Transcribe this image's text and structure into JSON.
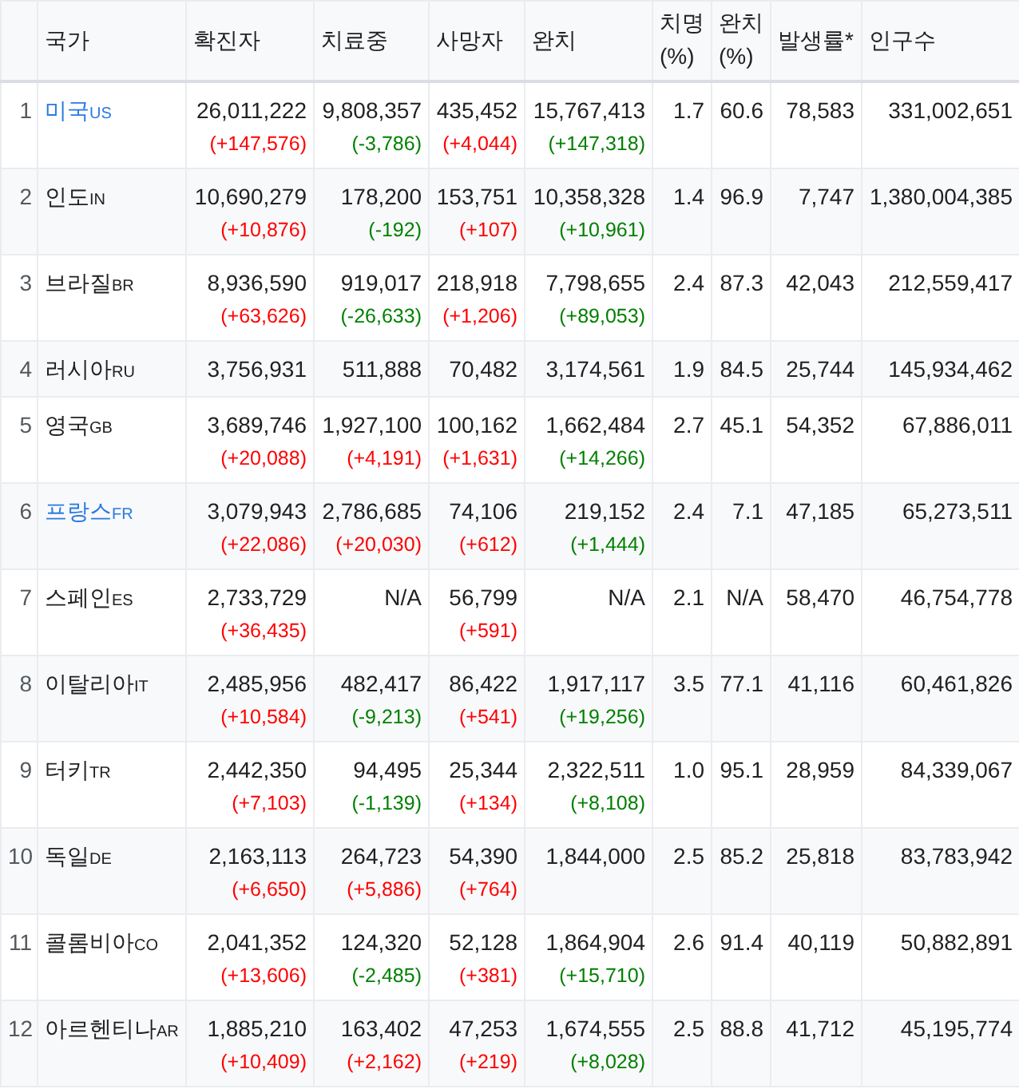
{
  "table": {
    "columns": [
      "국가",
      "확진자",
      "치료중",
      "사망자",
      "완치",
      "치명 (%)",
      "완치 (%)",
      "발생률*",
      "인구수"
    ],
    "rows": [
      {
        "rank": "1",
        "country": "미국",
        "code": "US",
        "linked": true,
        "confirmed": {
          "value": "26,011,222",
          "change": "(+147,576)",
          "kind": "worse"
        },
        "active": {
          "value": "9,808,357",
          "change": "(-3,786)",
          "kind": "better"
        },
        "deaths": {
          "value": "435,452",
          "change": "(+4,044)",
          "kind": "worse"
        },
        "recovered": {
          "value": "15,767,413",
          "change": "(+147,318)",
          "kind": "better"
        },
        "fatality": "1.7",
        "recovery_rate": "60.6",
        "incidence": "78,583",
        "population": "331,002,651"
      },
      {
        "rank": "2",
        "country": "인도",
        "code": "IN",
        "linked": false,
        "confirmed": {
          "value": "10,690,279",
          "change": "(+10,876)",
          "kind": "worse"
        },
        "active": {
          "value": "178,200",
          "change": "(-192)",
          "kind": "better"
        },
        "deaths": {
          "value": "153,751",
          "change": "(+107)",
          "kind": "worse"
        },
        "recovered": {
          "value": "10,358,328",
          "change": "(+10,961)",
          "kind": "better"
        },
        "fatality": "1.4",
        "recovery_rate": "96.9",
        "incidence": "7,747",
        "population": "1,380,004,385"
      },
      {
        "rank": "3",
        "country": "브라질",
        "code": "BR",
        "linked": false,
        "confirmed": {
          "value": "8,936,590",
          "change": "(+63,626)",
          "kind": "worse"
        },
        "active": {
          "value": "919,017",
          "change": "(-26,633)",
          "kind": "better"
        },
        "deaths": {
          "value": "218,918",
          "change": "(+1,206)",
          "kind": "worse"
        },
        "recovered": {
          "value": "7,798,655",
          "change": "(+89,053)",
          "kind": "better"
        },
        "fatality": "2.4",
        "recovery_rate": "87.3",
        "incidence": "42,043",
        "population": "212,559,417"
      },
      {
        "rank": "4",
        "country": "러시아",
        "code": "RU",
        "linked": false,
        "confirmed": {
          "value": "3,756,931"
        },
        "active": {
          "value": "511,888"
        },
        "deaths": {
          "value": "70,482"
        },
        "recovered": {
          "value": "3,174,561"
        },
        "fatality": "1.9",
        "recovery_rate": "84.5",
        "incidence": "25,744",
        "population": "145,934,462"
      },
      {
        "rank": "5",
        "country": "영국",
        "code": "GB",
        "linked": false,
        "confirmed": {
          "value": "3,689,746",
          "change": "(+20,088)",
          "kind": "worse"
        },
        "active": {
          "value": "1,927,100",
          "change": "(+4,191)",
          "kind": "worse"
        },
        "deaths": {
          "value": "100,162",
          "change": "(+1,631)",
          "kind": "worse"
        },
        "recovered": {
          "value": "1,662,484",
          "change": "(+14,266)",
          "kind": "better"
        },
        "fatality": "2.7",
        "recovery_rate": "45.1",
        "incidence": "54,352",
        "population": "67,886,011"
      },
      {
        "rank": "6",
        "country": "프랑스",
        "code": "FR",
        "linked": true,
        "confirmed": {
          "value": "3,079,943",
          "change": "(+22,086)",
          "kind": "worse"
        },
        "active": {
          "value": "2,786,685",
          "change": "(+20,030)",
          "kind": "worse"
        },
        "deaths": {
          "value": "74,106",
          "change": "(+612)",
          "kind": "worse"
        },
        "recovered": {
          "value": "219,152",
          "change": "(+1,444)",
          "kind": "better"
        },
        "fatality": "2.4",
        "recovery_rate": "7.1",
        "incidence": "47,185",
        "population": "65,273,511"
      },
      {
        "rank": "7",
        "country": "스페인",
        "code": "ES",
        "linked": false,
        "confirmed": {
          "value": "2,733,729",
          "change": "(+36,435)",
          "kind": "worse"
        },
        "active": {
          "value": "N/A"
        },
        "deaths": {
          "value": "56,799",
          "change": "(+591)",
          "kind": "worse"
        },
        "recovered": {
          "value": "N/A"
        },
        "fatality": "2.1",
        "recovery_rate": "N/A",
        "incidence": "58,470",
        "population": "46,754,778"
      },
      {
        "rank": "8",
        "country": "이탈리아",
        "code": "IT",
        "linked": false,
        "confirmed": {
          "value": "2,485,956",
          "change": "(+10,584)",
          "kind": "worse"
        },
        "active": {
          "value": "482,417",
          "change": "(-9,213)",
          "kind": "better"
        },
        "deaths": {
          "value": "86,422",
          "change": "(+541)",
          "kind": "worse"
        },
        "recovered": {
          "value": "1,917,117",
          "change": "(+19,256)",
          "kind": "better"
        },
        "fatality": "3.5",
        "recovery_rate": "77.1",
        "incidence": "41,116",
        "population": "60,461,826"
      },
      {
        "rank": "9",
        "country": "터키",
        "code": "TR",
        "linked": false,
        "confirmed": {
          "value": "2,442,350",
          "change": "(+7,103)",
          "kind": "worse"
        },
        "active": {
          "value": "94,495",
          "change": "(-1,139)",
          "kind": "better"
        },
        "deaths": {
          "value": "25,344",
          "change": "(+134)",
          "kind": "worse"
        },
        "recovered": {
          "value": "2,322,511",
          "change": "(+8,108)",
          "kind": "better"
        },
        "fatality": "1.0",
        "recovery_rate": "95.1",
        "incidence": "28,959",
        "population": "84,339,067"
      },
      {
        "rank": "10",
        "country": "독일",
        "code": "DE",
        "linked": false,
        "confirmed": {
          "value": "2,163,113",
          "change": "(+6,650)",
          "kind": "worse"
        },
        "active": {
          "value": "264,723",
          "change": "(+5,886)",
          "kind": "worse"
        },
        "deaths": {
          "value": "54,390",
          "change": "(+764)",
          "kind": "worse"
        },
        "recovered": {
          "value": "1,844,000"
        },
        "fatality": "2.5",
        "recovery_rate": "85.2",
        "incidence": "25,818",
        "population": "83,783,942"
      },
      {
        "rank": "11",
        "country": "콜롬비아",
        "code": "CO",
        "linked": false,
        "confirmed": {
          "value": "2,041,352",
          "change": "(+13,606)",
          "kind": "worse"
        },
        "active": {
          "value": "124,320",
          "change": "(-2,485)",
          "kind": "better"
        },
        "deaths": {
          "value": "52,128",
          "change": "(+381)",
          "kind": "worse"
        },
        "recovered": {
          "value": "1,864,904",
          "change": "(+15,710)",
          "kind": "better"
        },
        "fatality": "2.6",
        "recovery_rate": "91.4",
        "incidence": "40,119",
        "population": "50,882,891"
      },
      {
        "rank": "12",
        "country": "아르헨티나",
        "code": "AR",
        "linked": false,
        "confirmed": {
          "value": "1,885,210",
          "change": "(+10,409)",
          "kind": "worse"
        },
        "active": {
          "value": "163,402",
          "change": "(+2,162)",
          "kind": "worse"
        },
        "deaths": {
          "value": "47,253",
          "change": "(+219)",
          "kind": "worse"
        },
        "recovered": {
          "value": "1,674,555",
          "change": "(+8,028)",
          "kind": "better"
        },
        "fatality": "2.5",
        "recovery_rate": "88.8",
        "incidence": "41,712",
        "population": "45,195,774"
      }
    ]
  }
}
